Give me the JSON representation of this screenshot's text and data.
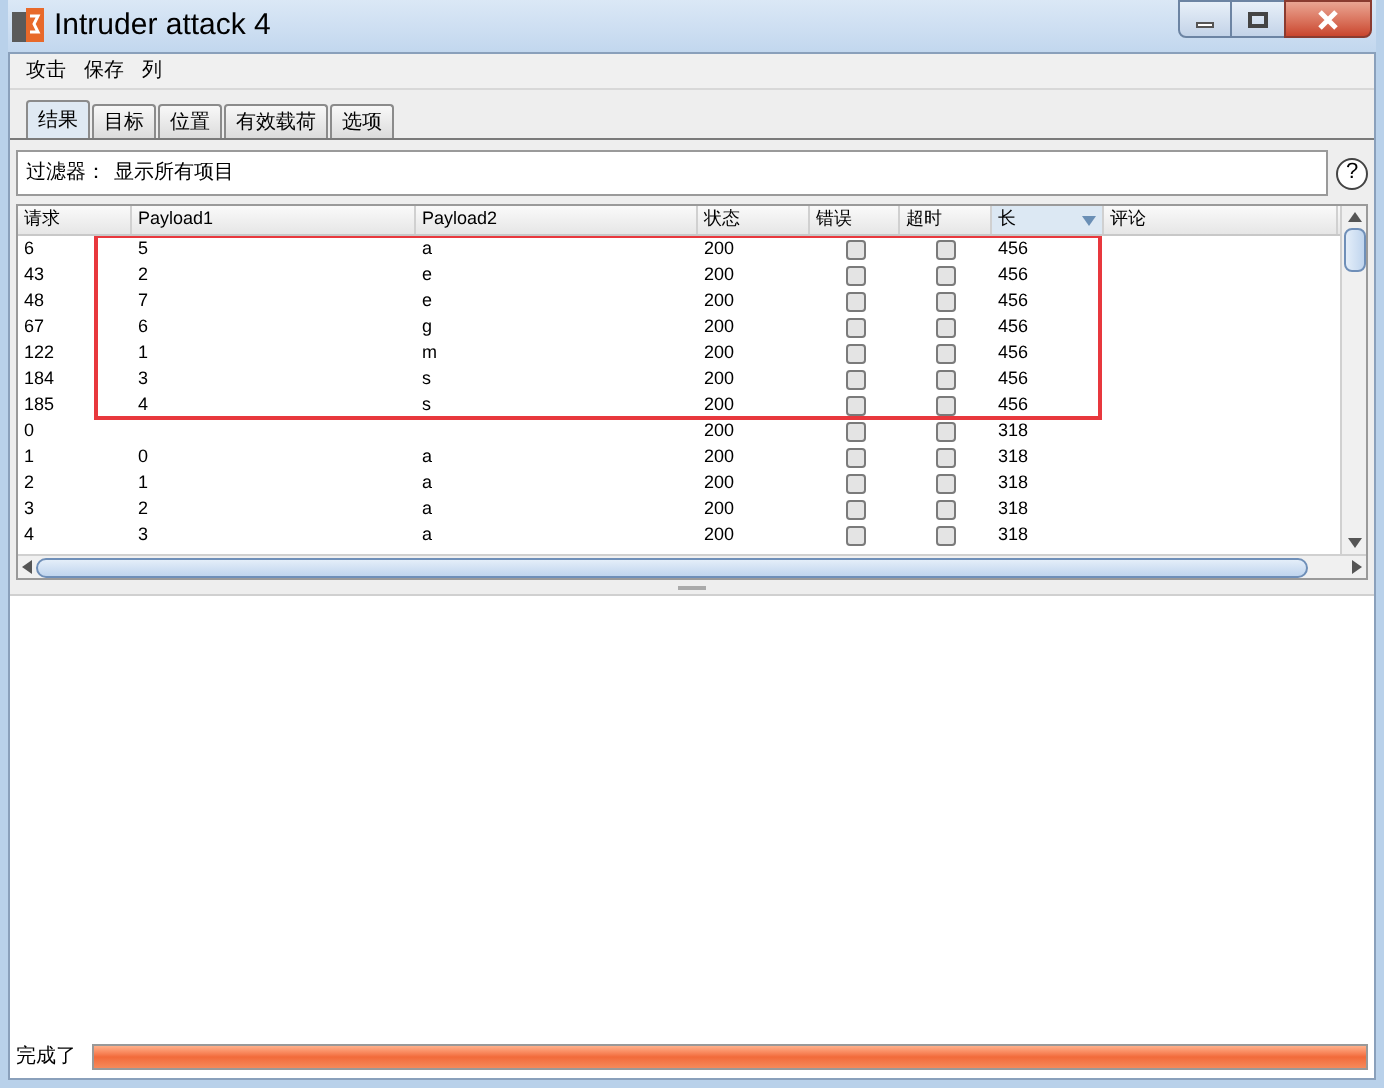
{
  "window": {
    "title": "Intruder attack 4"
  },
  "menu": [
    "攻击",
    "保存",
    "列"
  ],
  "tabs": [
    {
      "label": "结果",
      "selected": true
    },
    {
      "label": "目标",
      "selected": false
    },
    {
      "label": "位置",
      "selected": false
    },
    {
      "label": "有效载荷",
      "selected": false
    },
    {
      "label": "选项",
      "selected": false
    }
  ],
  "filter": {
    "label": "过滤器：",
    "value": "显示所有项目",
    "help": "?"
  },
  "table": {
    "columns": [
      {
        "label": "请求",
        "sorted": false
      },
      {
        "label": "Payload1",
        "sorted": false
      },
      {
        "label": "Payload2",
        "sorted": false
      },
      {
        "label": "状态",
        "sorted": false
      },
      {
        "label": "错误",
        "sorted": false
      },
      {
        "label": "超时",
        "sorted": false
      },
      {
        "label": "长",
        "sorted": true
      },
      {
        "label": "评论",
        "sorted": false
      }
    ],
    "rows": [
      {
        "request": "6",
        "payload1": "5",
        "payload2": "a",
        "status": "200",
        "error": false,
        "timeout": false,
        "length": "456",
        "highlighted": true
      },
      {
        "request": "43",
        "payload1": "2",
        "payload2": "e",
        "status": "200",
        "error": false,
        "timeout": false,
        "length": "456",
        "highlighted": true
      },
      {
        "request": "48",
        "payload1": "7",
        "payload2": "e",
        "status": "200",
        "error": false,
        "timeout": false,
        "length": "456",
        "highlighted": true
      },
      {
        "request": "67",
        "payload1": "6",
        "payload2": "g",
        "status": "200",
        "error": false,
        "timeout": false,
        "length": "456",
        "highlighted": true
      },
      {
        "request": "122",
        "payload1": "1",
        "payload2": "m",
        "status": "200",
        "error": false,
        "timeout": false,
        "length": "456",
        "highlighted": true
      },
      {
        "request": "184",
        "payload1": "3",
        "payload2": "s",
        "status": "200",
        "error": false,
        "timeout": false,
        "length": "456",
        "highlighted": true
      },
      {
        "request": "185",
        "payload1": "4",
        "payload2": "s",
        "status": "200",
        "error": false,
        "timeout": false,
        "length": "456",
        "highlighted": true
      },
      {
        "request": "0",
        "status": "200",
        "error": false,
        "timeout": false,
        "length": "318",
        "highlighted": false
      },
      {
        "request": "1",
        "payload1": "0",
        "payload2": "a",
        "status": "200",
        "error": false,
        "timeout": false,
        "length": "318",
        "highlighted": false
      },
      {
        "request": "2",
        "payload1": "1",
        "payload2": "a",
        "status": "200",
        "error": false,
        "timeout": false,
        "length": "318",
        "highlighted": false
      },
      {
        "request": "3",
        "payload1": "2",
        "payload2": "a",
        "status": "200",
        "error": false,
        "timeout": false,
        "length": "318",
        "highlighted": false
      },
      {
        "request": "4",
        "payload1": "3",
        "payload2": "a",
        "status": "200",
        "error": false,
        "timeout": false,
        "length": "318",
        "highlighted": false
      }
    ]
  },
  "status_bar": {
    "text": "完成了",
    "level": 1
  }
}
